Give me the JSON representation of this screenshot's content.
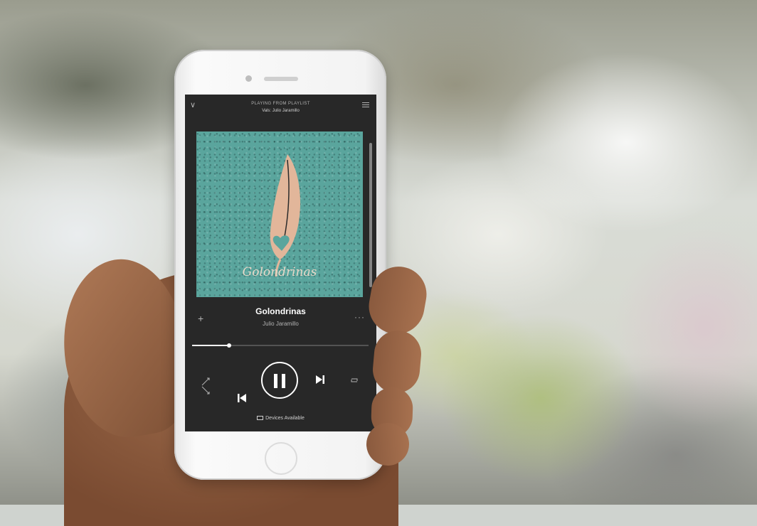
{
  "header": {
    "context_label": "PLAYING FROM PLAYLIST",
    "playlist_name": "Vals: Julio Jaramillo"
  },
  "cover": {
    "title": "Golondrinas"
  },
  "track": {
    "title": "Golondrinas",
    "artist": "Julio Jaramillo",
    "progress": 0.21
  },
  "controls": {
    "add": "+",
    "more": "···"
  },
  "footer": {
    "devices_label": "Devices Available"
  },
  "colors": {
    "screen_bg": "#282828",
    "cover_bg": "#5aa59d",
    "feather": "#e2b69a"
  },
  "icons": [
    "chevron-down-icon",
    "queue-icon",
    "add-icon",
    "more-icon",
    "shuffle-icon",
    "previous-icon",
    "pause-icon",
    "next-icon",
    "repeat-icon",
    "devices-icon"
  ]
}
